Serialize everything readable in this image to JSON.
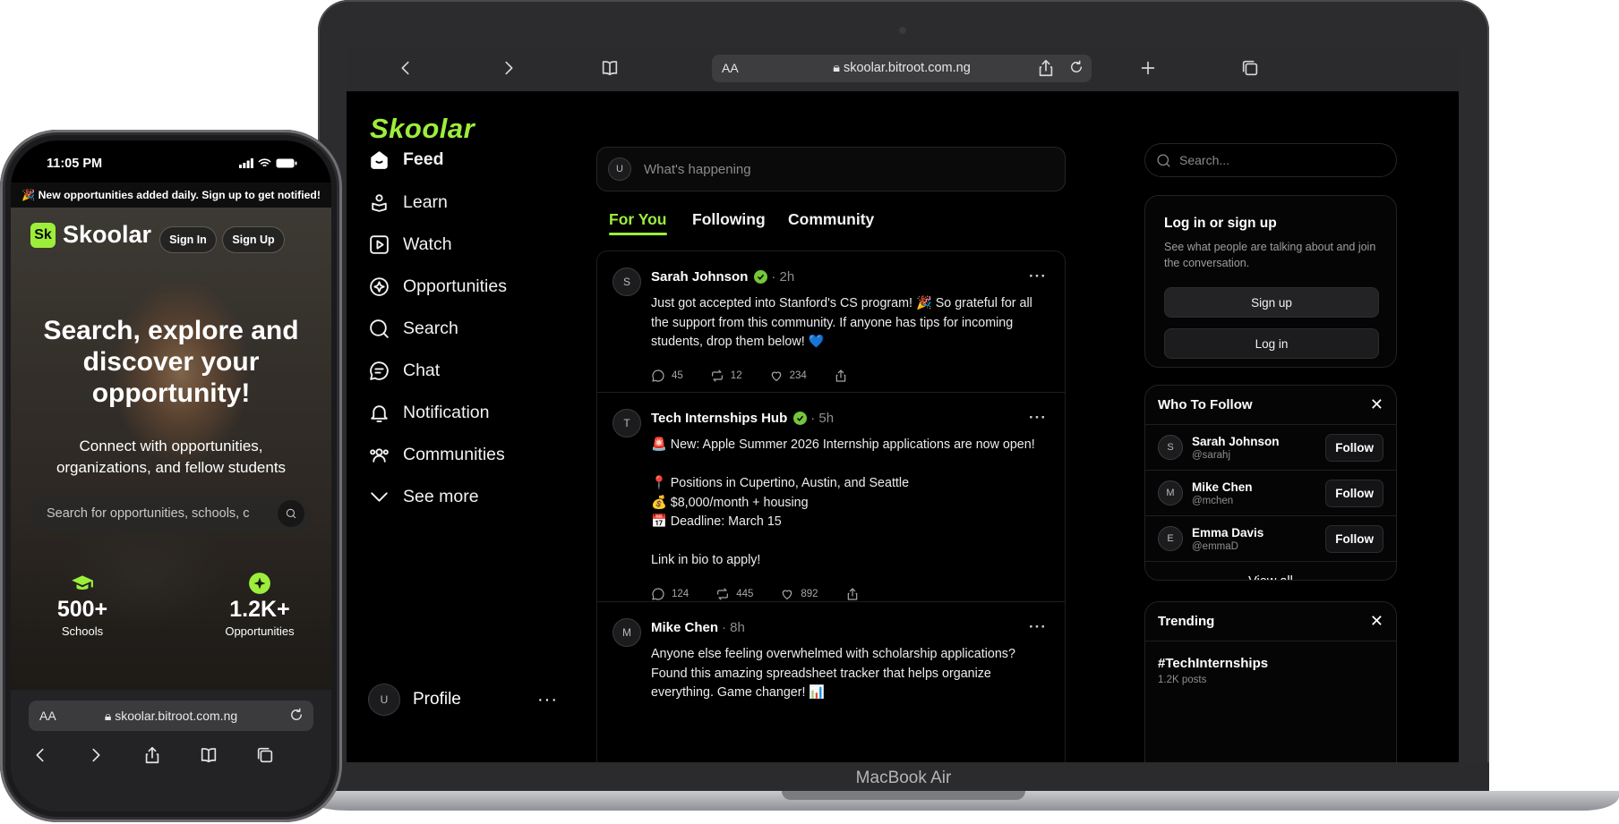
{
  "laptop": {
    "model_label": "MacBook Air",
    "browser": {
      "aa_label": "AA",
      "url": "skoolar.bitroot.com.ng"
    },
    "app": {
      "logo": "Skoolar",
      "accent_color": "#9dee3b",
      "nav": [
        {
          "label": "Feed",
          "icon": "feed-icon"
        },
        {
          "label": "Learn",
          "icon": "learn-icon"
        },
        {
          "label": "Watch",
          "icon": "watch-icon"
        },
        {
          "label": "Opportunities",
          "icon": "opportunities-icon"
        },
        {
          "label": "Search",
          "icon": "search-icon"
        },
        {
          "label": "Chat",
          "icon": "chat-icon"
        },
        {
          "label": "Notification",
          "icon": "bell-icon"
        },
        {
          "label": "Communities",
          "icon": "communities-icon"
        },
        {
          "label": "See more",
          "icon": "chevron-down-icon"
        }
      ],
      "profile": {
        "initial": "U",
        "label": "Profile",
        "more": "···"
      },
      "compose": {
        "initial": "U",
        "placeholder": "What's happening"
      },
      "tabs": [
        "For You",
        "Following",
        "Community"
      ],
      "posts": [
        {
          "initial": "S",
          "author": "Sarah Johnson",
          "verified": true,
          "time": "· 2h",
          "text": "Just got accepted into Stanford's CS program! 🎉 So grateful for all the support from this community. If anyone has tips for incoming students, drop them below! 💙",
          "replies": "45",
          "reposts": "12",
          "likes": "234"
        },
        {
          "initial": "T",
          "author": "Tech Internships Hub",
          "verified": true,
          "time": "· 5h",
          "text": "🚨 New: Apple Summer 2026 Internship applications are now open!\n\n📍 Positions in Cupertino, Austin, and Seattle\n💰 $8,000/month + housing\n📅 Deadline: March 15\n\nLink in bio to apply!",
          "replies": "124",
          "reposts": "445",
          "likes": "892"
        },
        {
          "initial": "M",
          "author": "Mike Chen",
          "verified": false,
          "time": "· 8h",
          "text": "Anyone else feeling overwhelmed with scholarship applications? Found this amazing spreadsheet tracker that helps organize everything. Game changer! 📊",
          "replies": "",
          "reposts": "",
          "likes": ""
        }
      ],
      "right": {
        "search_placeholder": "Search...",
        "login": {
          "title": "Log in or sign up",
          "desc": "See what people are talking about and join the conversation.",
          "signup": "Sign up",
          "login": "Log in"
        },
        "who_to_follow": {
          "title": "Who To Follow",
          "users": [
            {
              "initial": "S",
              "name": "Sarah Johnson",
              "handle": "@sarahj",
              "action": "Follow"
            },
            {
              "initial": "M",
              "name": "Mike Chen",
              "handle": "@mchen",
              "action": "Follow"
            },
            {
              "initial": "E",
              "name": "Emma Davis",
              "handle": "@emmaD",
              "action": "Follow"
            }
          ],
          "view_all": "View all"
        },
        "trending": {
          "title": "Trending",
          "items": [
            {
              "tag": "#TechInternships",
              "count": "1.2K posts"
            }
          ]
        }
      }
    }
  },
  "phone": {
    "time": "11:05 PM",
    "banner": "🎉 New opportunities added daily. Sign up to get notified!",
    "logo_mark": "Sk",
    "logo": "Skoolar",
    "sign_in": "Sign In",
    "sign_up": "Sign Up",
    "hero": [
      "Search, explore and",
      "discover your",
      "opportunity!"
    ],
    "subtitle": [
      "Connect with opportunities,",
      "organizations, and fellow students"
    ],
    "search_placeholder": "Search for opportunities, schools, c",
    "stats": [
      {
        "value": "500+",
        "label": "Schools",
        "icon": "graduation-cap-icon"
      },
      {
        "value": "1.2K+",
        "label": "Opportunities",
        "icon": "sparkle-badge-icon"
      }
    ],
    "browser": {
      "aa_label": "AA",
      "url": "skoolar.bitroot.com.ng"
    }
  }
}
